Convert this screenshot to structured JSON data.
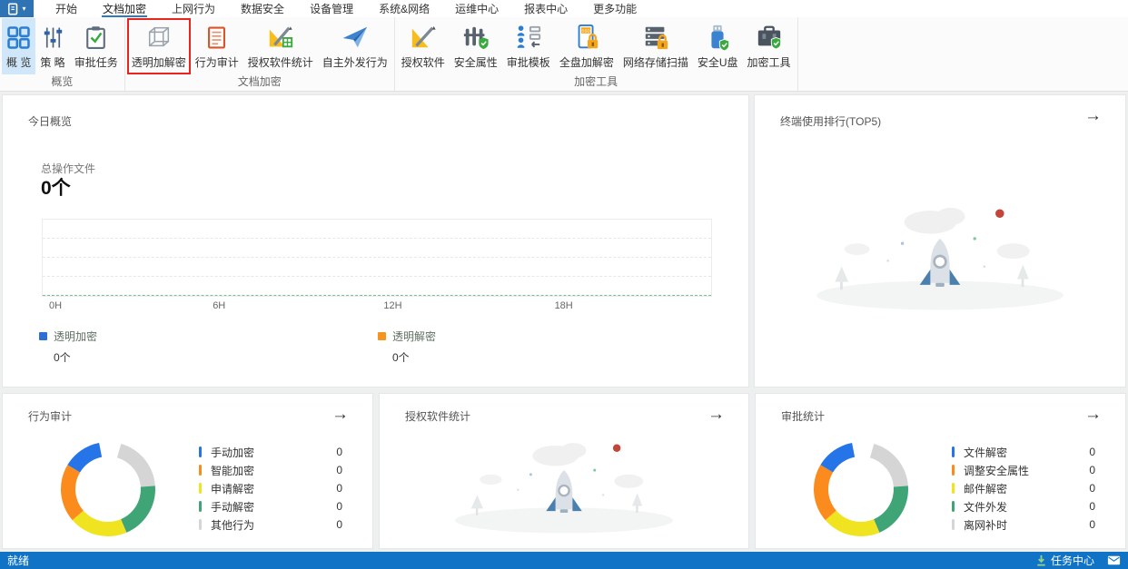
{
  "icons": {
    "arrow": "→",
    "caret": "▾"
  },
  "menu": {
    "tabs": [
      {
        "label": "开始",
        "active": false
      },
      {
        "label": "文档加密",
        "active": true
      },
      {
        "label": "上网行为",
        "active": false
      },
      {
        "label": "数据安全",
        "active": false
      },
      {
        "label": "设备管理",
        "active": false
      },
      {
        "label": "系统&网络",
        "active": false
      },
      {
        "label": "运维中心",
        "active": false
      },
      {
        "label": "报表中心",
        "active": false
      },
      {
        "label": "更多功能",
        "active": false
      }
    ]
  },
  "ribbon": {
    "groups": [
      {
        "label": "概览",
        "items": [
          {
            "label": "概 览",
            "icon": "overview-grid-icon",
            "selected": true
          },
          {
            "label": "策 略",
            "icon": "policy-sliders-icon"
          },
          {
            "label": "审批任务",
            "icon": "approval-tasks-icon"
          }
        ]
      },
      {
        "label": "文档加密",
        "items": [
          {
            "label": "透明加解密",
            "icon": "transparent-crypto-cube-icon",
            "highlighted": true
          },
          {
            "label": "行为审计",
            "icon": "behavior-audit-icon"
          },
          {
            "label": "授权软件统计",
            "icon": "authorized-software-stats-icon"
          },
          {
            "label": "自主外发行为",
            "icon": "outgoing-behavior-icon"
          }
        ]
      },
      {
        "label": "加密工具",
        "items": [
          {
            "label": "授权软件",
            "icon": "authorized-software-icon"
          },
          {
            "label": "安全属性",
            "icon": "security-attribute-icon"
          },
          {
            "label": "审批模板",
            "icon": "approval-template-icon"
          },
          {
            "label": "全盘加解密",
            "icon": "full-disk-crypto-icon"
          },
          {
            "label": "网络存储扫描",
            "icon": "network-storage-scan-icon"
          },
          {
            "label": "安全U盘",
            "icon": "secure-usb-icon"
          },
          {
            "label": "加密工具",
            "icon": "crypto-tools-icon"
          }
        ]
      }
    ]
  },
  "cards": {
    "today": {
      "title": "今日概览",
      "stat_label": "总操作文件",
      "stat_value": "0个",
      "x_ticks": [
        "0H",
        "6H",
        "12H",
        "18H"
      ],
      "legend": [
        {
          "label": "透明加密",
          "value": "0个",
          "color": "#2e6fd6"
        },
        {
          "label": "透明解密",
          "value": "0个",
          "color": "#f5941e"
        }
      ]
    },
    "terminal_rank": {
      "title": "终端使用排行(TOP5)"
    },
    "behavior_audit": {
      "title": "行为审计",
      "legend": [
        {
          "label": "手动加密",
          "value": "0",
          "color": "#2574e8"
        },
        {
          "label": "智能加密",
          "value": "0",
          "color": "#fb8b1c"
        },
        {
          "label": "申请解密",
          "value": "0",
          "color": "#f0e320"
        },
        {
          "label": "手动解密",
          "value": "0",
          "color": "#3fa577"
        },
        {
          "label": "其他行为",
          "value": "0",
          "color": "#d5d5d5"
        }
      ]
    },
    "software_stats": {
      "title": "授权软件统计"
    },
    "approval_stats": {
      "title": "审批统计",
      "legend": [
        {
          "label": "文件解密",
          "value": "0",
          "color": "#2574e8"
        },
        {
          "label": "调整安全属性",
          "value": "0",
          "color": "#fb8b1c"
        },
        {
          "label": "邮件解密",
          "value": "0",
          "color": "#f0e320"
        },
        {
          "label": "文件外发",
          "value": "0",
          "color": "#3fa577"
        },
        {
          "label": "离网补时",
          "value": "0",
          "color": "#d5d5d5"
        }
      ]
    }
  },
  "donut": {
    "segments": [
      {
        "color": "#d5d5d5",
        "start": 16,
        "end": 86
      },
      {
        "color": "#3fa577",
        "start": 86,
        "end": 157
      },
      {
        "color": "#f0e320",
        "start": 157,
        "end": 229
      },
      {
        "color": "#fb8b1c",
        "start": 229,
        "end": 301
      },
      {
        "color": "#2574e8",
        "start": 301,
        "end": 349
      }
    ]
  },
  "status_bar": {
    "ready": "就绪",
    "task_center": "任务中心"
  },
  "chart_data": [
    {
      "type": "line",
      "title": "今日概览",
      "x": [
        "0H",
        "6H",
        "12H",
        "18H"
      ],
      "series": [
        {
          "name": "透明加密",
          "values": [
            0,
            0,
            0,
            0
          ]
        },
        {
          "name": "透明解密",
          "values": [
            0,
            0,
            0,
            0
          ]
        }
      ],
      "ylim": [
        0,
        1
      ],
      "grid": "dashed-horizontal",
      "legend_position": "bottom"
    },
    {
      "type": "pie",
      "title": "行为审计",
      "categories": [
        "手动加密",
        "智能加密",
        "申请解密",
        "手动解密",
        "其他行为"
      ],
      "values": [
        0,
        0,
        0,
        0,
        0
      ],
      "legend_position": "right"
    },
    {
      "type": "pie",
      "title": "审批统计",
      "categories": [
        "文件解密",
        "调整安全属性",
        "邮件解密",
        "文件外发",
        "离网补时"
      ],
      "values": [
        0,
        0,
        0,
        0,
        0
      ],
      "legend_position": "right"
    }
  ]
}
